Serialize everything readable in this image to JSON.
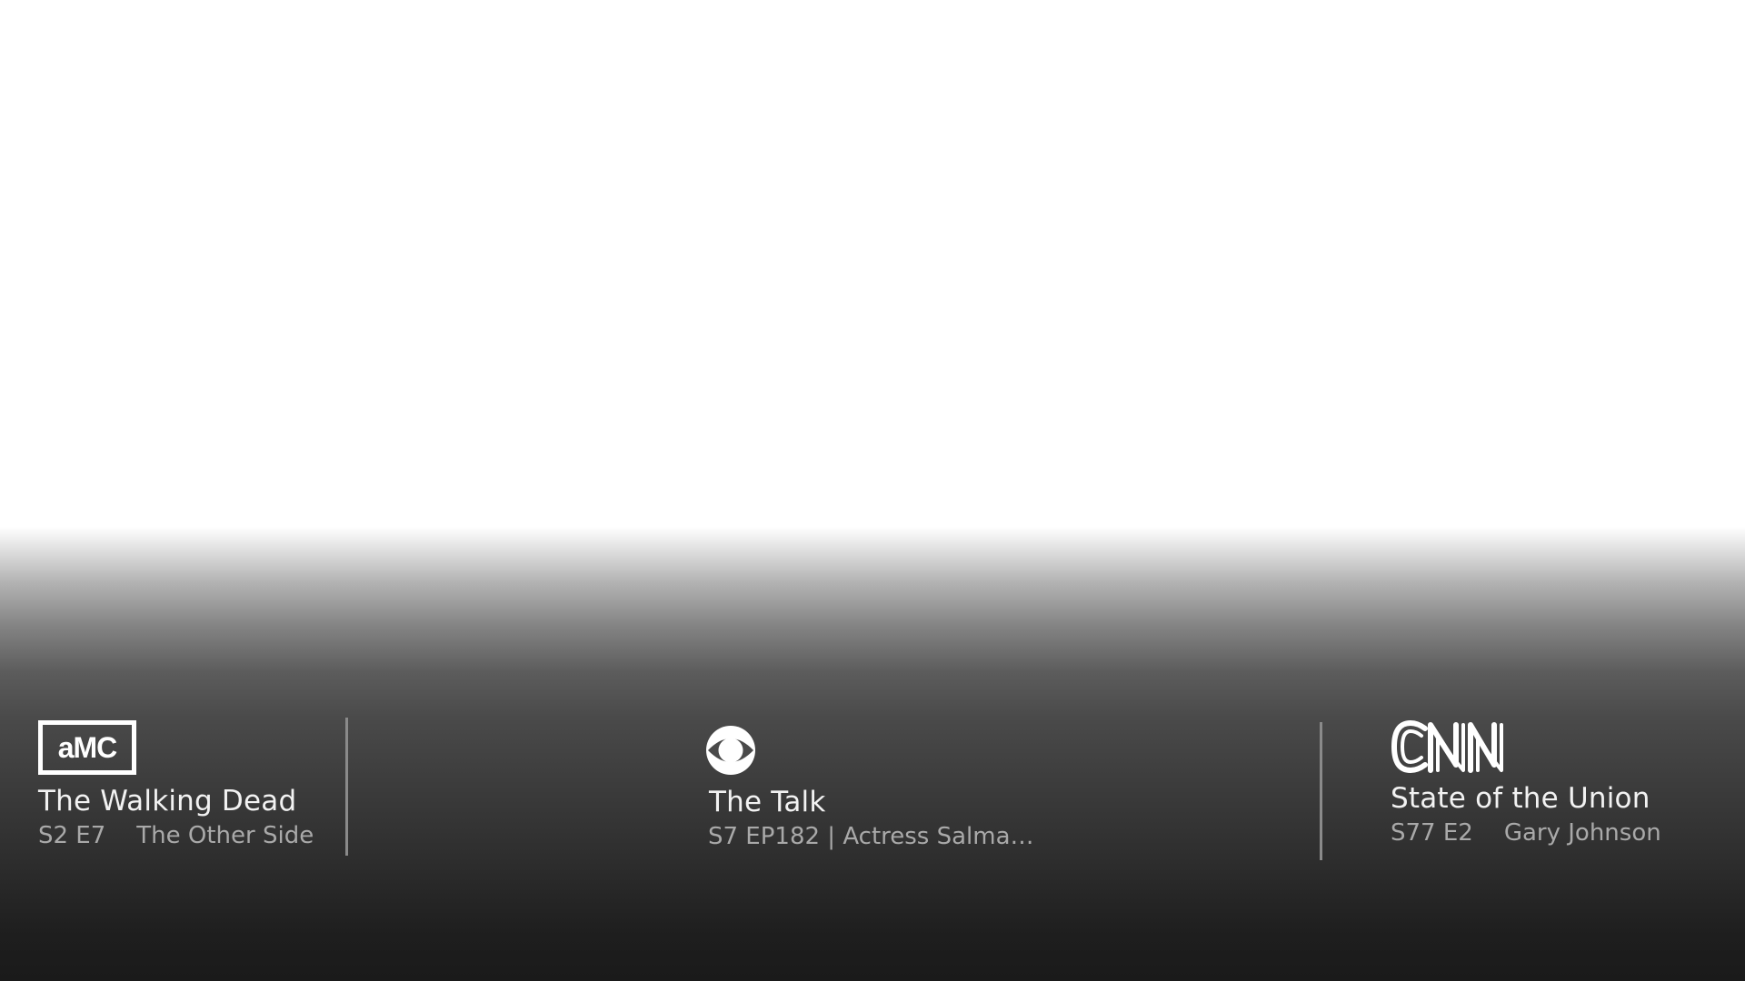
{
  "channels": [
    {
      "network": "AMC",
      "logo_icon": "amc-logo-icon",
      "title": "The Walking Dead",
      "episode": "S2 E7",
      "episode_title": "The Other Side"
    },
    {
      "network": "CBS",
      "logo_icon": "cbs-eye-logo-icon",
      "title": "The Talk",
      "subtitle": "S7 EP182 | Actress Salma…"
    },
    {
      "network": "CNN",
      "logo_icon": "cnn-logo-icon",
      "title": "State of the Union",
      "episode": "S77 E2",
      "episode_title": "Gary Johnson"
    }
  ],
  "colors": {
    "title": "#f2f2f2",
    "meta": "#a9a9a9",
    "divider": "#8a8a8a",
    "gradient_bottom": "#1a1a1a"
  }
}
